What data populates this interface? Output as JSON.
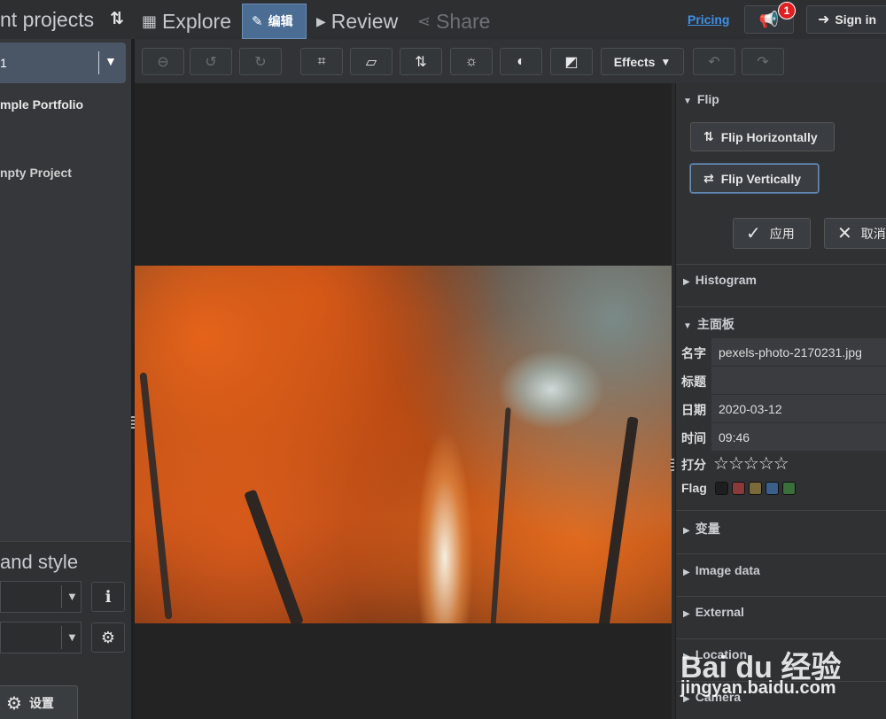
{
  "left_header": {
    "title": "nt projects",
    "sort_icon": "sort-arrows-icon"
  },
  "nav": {
    "explore": "Explore",
    "edit": "编辑",
    "review": "Review",
    "share": "Share",
    "pricing": "Pricing",
    "badge_count": "1",
    "sign_in": "Sign in"
  },
  "projects": {
    "selected": "1",
    "items": [
      "mple Portfolio",
      "npty Project"
    ]
  },
  "style_section": {
    "title": "and style",
    "settings_label": "设置"
  },
  "toolbar": {
    "effects_label": "Effects"
  },
  "panel": {
    "flip": {
      "header": "Flip",
      "flip_horizontally": "Flip Horizontally",
      "flip_vertically": "Flip Vertically",
      "apply": "应用",
      "cancel": "取消"
    },
    "histogram": "Histogram",
    "main_panel": "主面板",
    "metadata": {
      "name_label": "名字",
      "name_value": "pexels-photo-2170231.jpg",
      "title_label": "标题",
      "title_value": "",
      "date_label": "日期",
      "date_value": "2020-03-12",
      "time_label": "时间",
      "time_value": "09:46",
      "rating_label": "打分",
      "rating_value": 0,
      "rating_max": 5,
      "flag_label": "Flag",
      "flag_colors": [
        "#1e1e1e",
        "#8b3a3a",
        "#7a6a3a",
        "#3a5f8b",
        "#3a6e3a"
      ]
    },
    "variables": "变量",
    "image_data": "Image data",
    "external": "External",
    "location": "Location",
    "camera": "Camera"
  },
  "watermark": {
    "logo": "Bai du 经验",
    "url": "jingyan.baidu.com"
  },
  "colors": {
    "accent": "#4b6d94",
    "link": "#3e90e8",
    "badge": "#e02020"
  }
}
